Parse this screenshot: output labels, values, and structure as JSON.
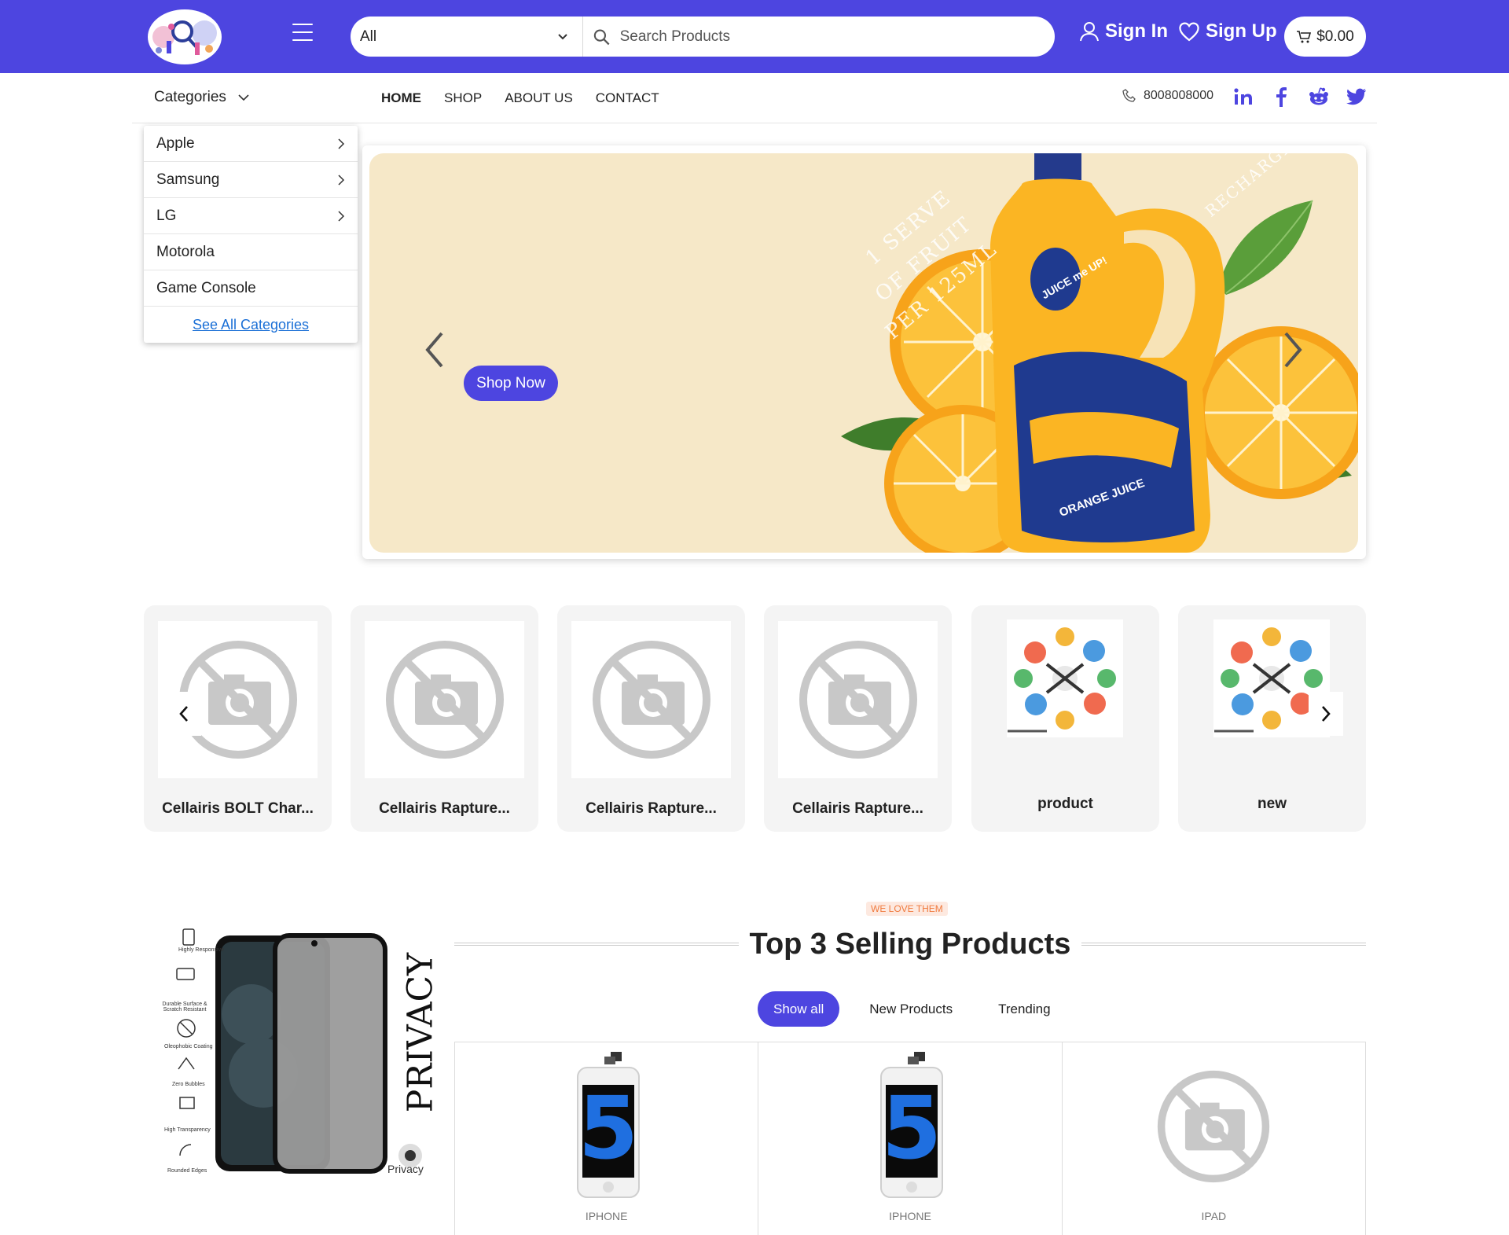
{
  "header": {
    "search_category": "All",
    "search_placeholder": "Search Products",
    "sign_in": "Sign In",
    "sign_up": "Sign Up",
    "cart_total": "$0.00"
  },
  "nav": {
    "categories_label": "Categories",
    "links": [
      "HOME",
      "SHOP",
      "ABOUT US",
      "CONTACT"
    ],
    "active_link": "HOME",
    "phone": "8008008000",
    "socials": [
      "linkedin-icon",
      "facebook-icon",
      "reddit-icon",
      "twitter-icon"
    ]
  },
  "category_menu": {
    "items": [
      {
        "label": "Apple",
        "has_submenu": true
      },
      {
        "label": "Samsung",
        "has_submenu": true
      },
      {
        "label": "LG",
        "has_submenu": true
      },
      {
        "label": "Motorola",
        "has_submenu": false
      },
      {
        "label": "Game Console",
        "has_submenu": false
      }
    ],
    "see_all": "See All Categories"
  },
  "hero": {
    "cta": "Shop Now",
    "stamp_lines": [
      "1 SERVE",
      "OF FRUIT",
      "PER 125ML"
    ],
    "recharge": "RECHARGE",
    "brand": "JUICE me UP!",
    "product": "ORANGE JUICE"
  },
  "products": [
    {
      "name": "Cellairis BOLT Char...",
      "image": "no-image-icon"
    },
    {
      "name": "Cellairis Rapture...",
      "image": "no-image-icon"
    },
    {
      "name": "Cellairis Rapture...",
      "image": "no-image-icon"
    },
    {
      "name": "Cellairis Rapture...",
      "image": "no-image-icon"
    },
    {
      "name": "product",
      "image": "team-illustration"
    },
    {
      "name": "new",
      "image": "team-illustration"
    }
  ],
  "promo": {
    "vertical_text": "PRIVACY",
    "corner_text": "Privacy",
    "features": [
      "Highly Responsive",
      "Durable Surface & Scratch Resistant",
      "Oleophobic Coating",
      "Zero Bubbles",
      "High Transparency",
      "Rounded Edges"
    ]
  },
  "top_selling": {
    "eyebrow": "WE LOVE THEM",
    "title": "Top 3 Selling Products",
    "tabs": [
      "Show all",
      "New Products",
      "Trending"
    ],
    "active_tab": "Show all",
    "items": [
      {
        "category": "IPHONE",
        "image": "iphone-5-screen"
      },
      {
        "category": "IPHONE",
        "image": "iphone-5-screen"
      },
      {
        "category": "IPAD",
        "image": "no-image-icon"
      }
    ]
  },
  "colors": {
    "brand": "#4d45e0",
    "hero_bg": "#f6e8c8",
    "link": "#1a6fd6",
    "eyebrow": "#f07b3f"
  }
}
